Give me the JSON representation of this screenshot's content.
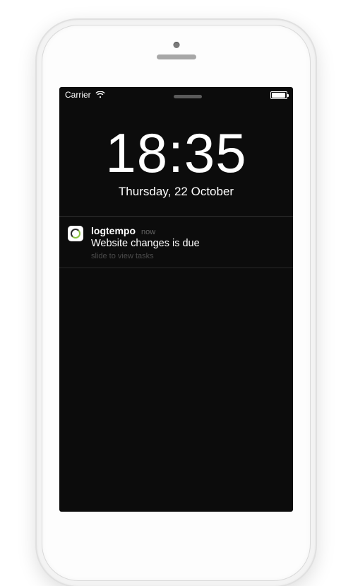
{
  "status_bar": {
    "carrier": "Carrier"
  },
  "lockscreen": {
    "time": "18:35",
    "date": "Thursday, 22 October"
  },
  "notification": {
    "app_name": "logtempo",
    "timestamp": "now",
    "body": "Website changes is due",
    "hint": "slide to view tasks"
  }
}
